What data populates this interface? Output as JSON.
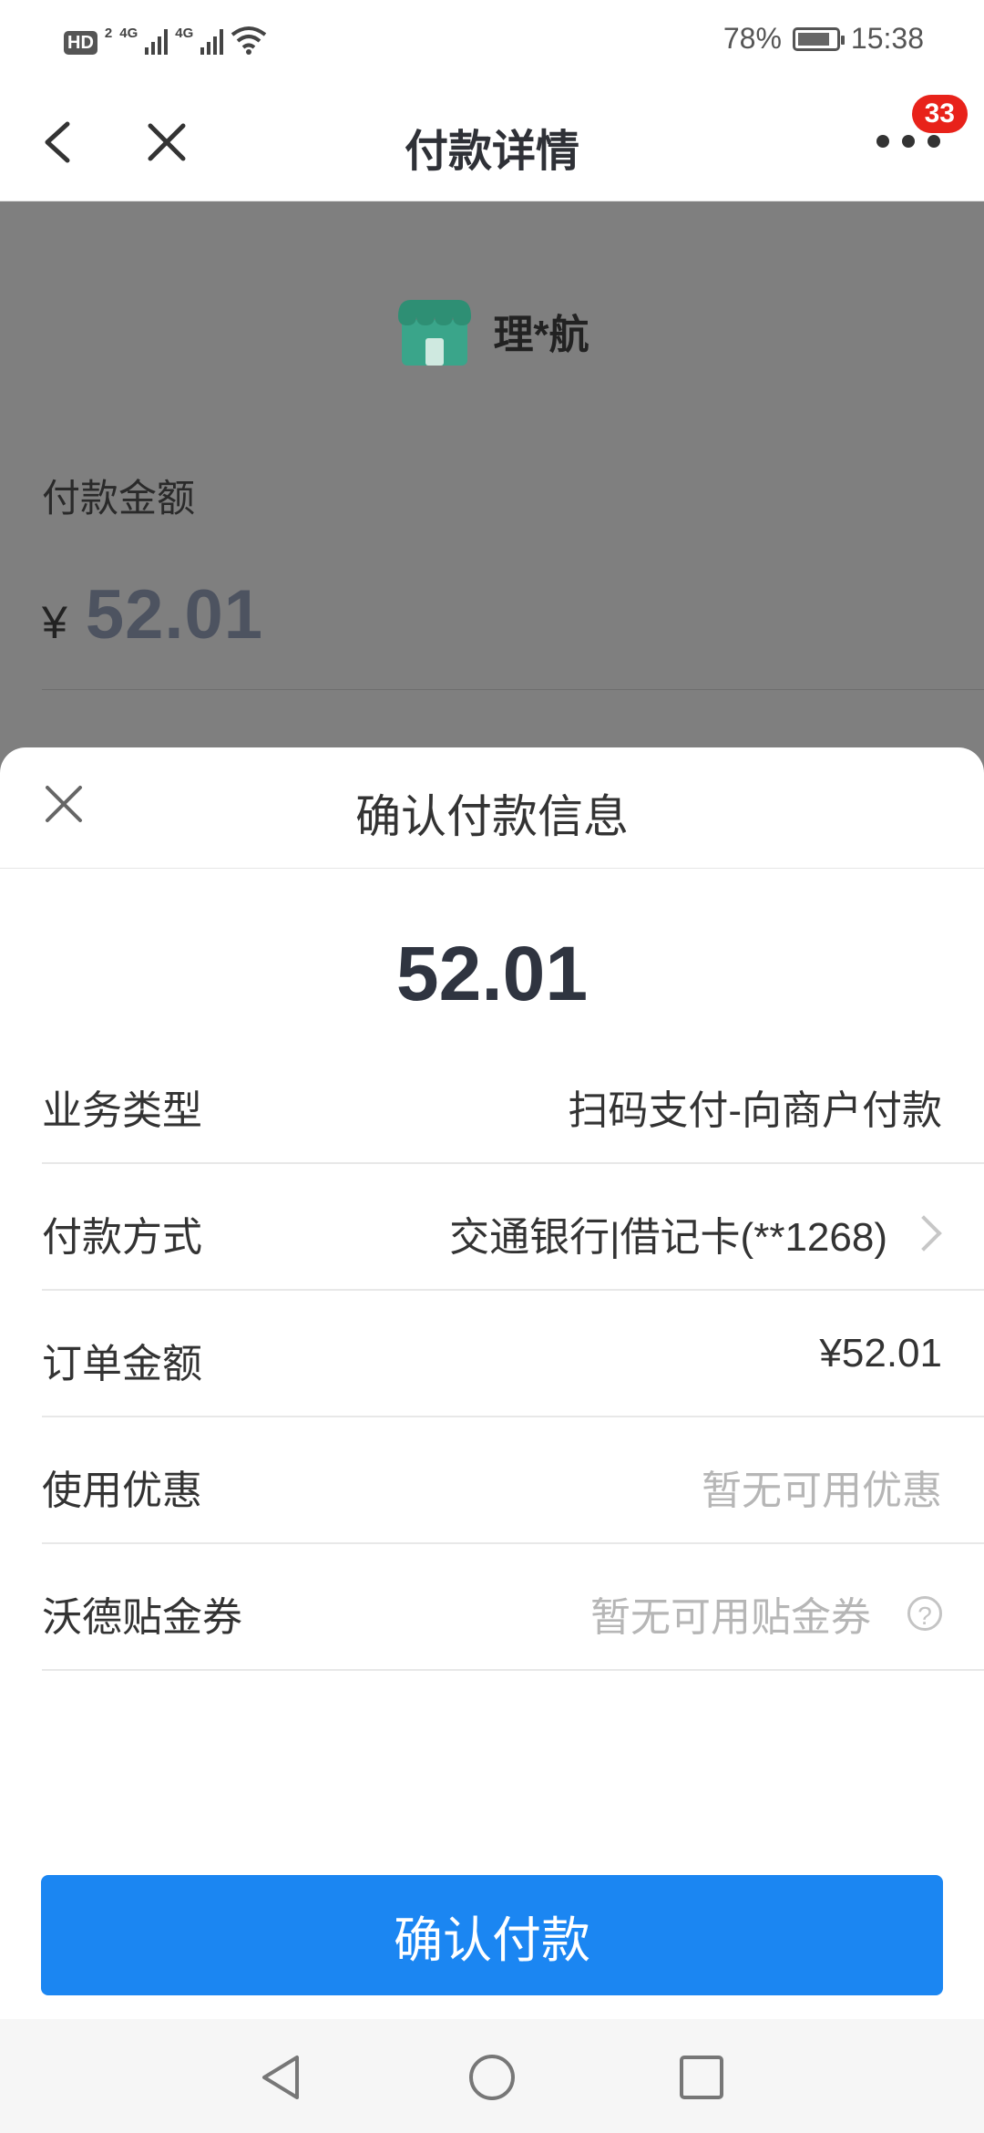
{
  "status_bar": {
    "hd_label": "HD",
    "hd_sub": "2",
    "net1": "4G",
    "net2": "4G",
    "battery_percent": "78%",
    "time": "15:38"
  },
  "nav": {
    "title": "付款详情",
    "badge_count": "33"
  },
  "background_page": {
    "merchant_name": "理*航",
    "amount_label": "付款金额",
    "currency_symbol": "¥",
    "amount": "52.01"
  },
  "sheet": {
    "title": "确认付款信息",
    "amount": "52.01",
    "rows": [
      {
        "label": "业务类型",
        "value": "扫码支付-向商户付款"
      },
      {
        "label": "付款方式",
        "value": "交通银行|借记卡(**1268)"
      },
      {
        "label": "订单金额",
        "value": "¥52.01"
      },
      {
        "label": "使用优惠",
        "value": "暂无可用优惠"
      },
      {
        "label": "沃德贴金券",
        "value": "暂无可用贴金券"
      }
    ],
    "help_icon_text": "?",
    "confirm_label": "确认付款"
  },
  "colors": {
    "primary": "#1b86f2",
    "badge": "#e8221a",
    "overlay": "#7f7f7f"
  },
  "icons": [
    "back-icon",
    "close-icon",
    "more-icon",
    "store-icon",
    "chevron-right-icon",
    "help-icon",
    "triangle-back-icon",
    "circle-home-icon",
    "square-recent-icon"
  ]
}
